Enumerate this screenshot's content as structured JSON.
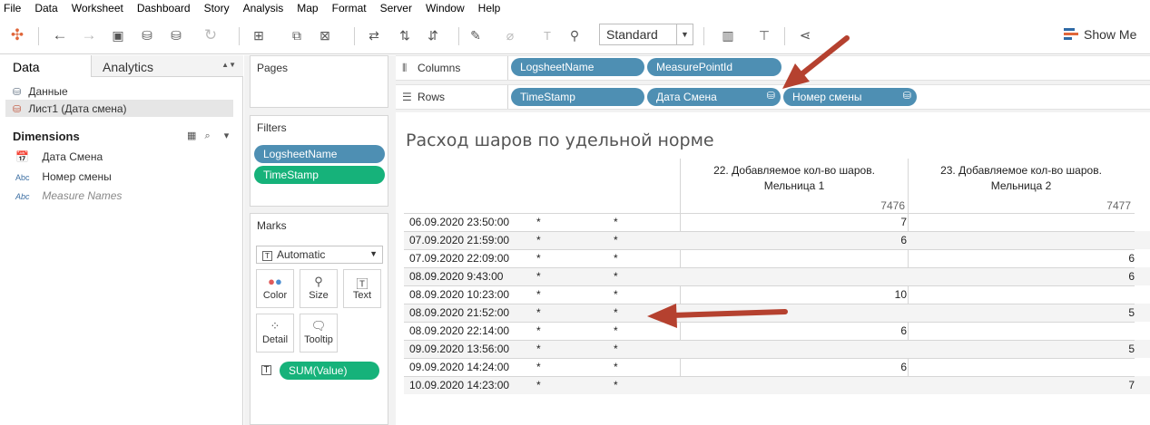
{
  "menu": [
    "File",
    "Data",
    "Worksheet",
    "Dashboard",
    "Story",
    "Analysis",
    "Map",
    "Format",
    "Server",
    "Window",
    "Help"
  ],
  "toolbar": {
    "fit_value": "Standard",
    "show_me_label": "Show Me"
  },
  "data_pane": {
    "tab_data": "Data",
    "tab_analytics": "Analytics",
    "datasources": [
      "Данные",
      "Лист1 (Дата смена)"
    ],
    "dimensions_header": "Dimensions",
    "fields": [
      {
        "type": "date",
        "name": "Дата Смена"
      },
      {
        "type": "Abc",
        "name": "Номер смены"
      },
      {
        "type": "Abc",
        "name": "Measure Names"
      }
    ]
  },
  "pages": {
    "title": "Pages"
  },
  "filters": {
    "title": "Filters",
    "pills": [
      "LogsheetName",
      "TimeStamp"
    ]
  },
  "marks": {
    "title": "Marks",
    "type": "Automatic",
    "buttons": [
      "Color",
      "Size",
      "Text",
      "Detail",
      "Tooltip"
    ],
    "text_pill": "SUM(Value)"
  },
  "shelves": {
    "columns_label": "Columns",
    "rows_label": "Rows",
    "columns": [
      "LogsheetName",
      "MeasurePointId"
    ],
    "rows": [
      "TimeStamp",
      "Дата Смена",
      "Номер смены"
    ]
  },
  "viz": {
    "title": "Расход шаров по удельной норме",
    "col_headers": [
      {
        "name_line1": "22. Добавляемое кол-во шаров.",
        "name_line2": "Мельница 1",
        "id": "7476"
      },
      {
        "name_line1": "23. Добавляемое кол-во шаров.",
        "name_line2": "Мельница 2",
        "id": "7477"
      }
    ],
    "rows": [
      {
        "ts": "06.09.2020 23:50:00",
        "d": "*",
        "n": "*",
        "v1": "7",
        "v2": ""
      },
      {
        "ts": "07.09.2020 21:59:00",
        "d": "*",
        "n": "*",
        "v1": "6",
        "v2": ""
      },
      {
        "ts": "07.09.2020 22:09:00",
        "d": "*",
        "n": "*",
        "v1": "",
        "v2": "6"
      },
      {
        "ts": "08.09.2020 9:43:00",
        "d": "*",
        "n": "*",
        "v1": "",
        "v2": "6"
      },
      {
        "ts": "08.09.2020 10:23:00",
        "d": "*",
        "n": "*",
        "v1": "10",
        "v2": ""
      },
      {
        "ts": "08.09.2020 21:52:00",
        "d": "*",
        "n": "*",
        "v1": "",
        "v2": "5"
      },
      {
        "ts": "08.09.2020 22:14:00",
        "d": "*",
        "n": "*",
        "v1": "6",
        "v2": ""
      },
      {
        "ts": "09.09.2020 13:56:00",
        "d": "*",
        "n": "*",
        "v1": "",
        "v2": "5"
      },
      {
        "ts": "09.09.2020 14:24:00",
        "d": "*",
        "n": "*",
        "v1": "6",
        "v2": ""
      },
      {
        "ts": "10.09.2020 14:23:00",
        "d": "*",
        "n": "*",
        "v1": "",
        "v2": "7"
      }
    ]
  },
  "colors": {
    "pill_blue": "#4e8fb3",
    "pill_green": "#16b27a",
    "annotation_arrow": "#b5412f"
  }
}
